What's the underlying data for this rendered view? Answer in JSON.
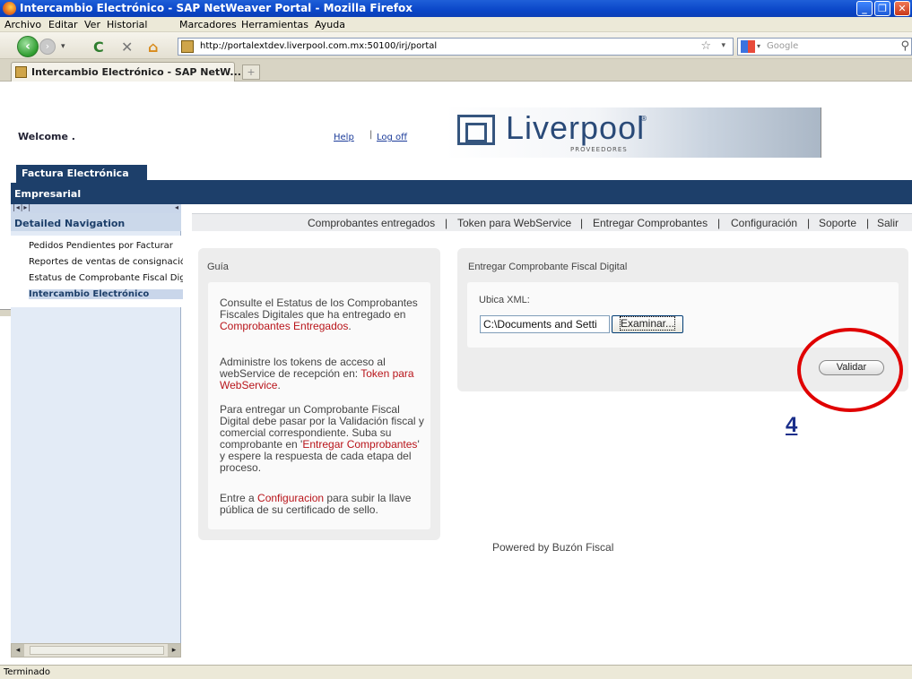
{
  "window": {
    "title": "Intercambio Electrónico - SAP NetWeaver Portal - Mozilla Firefox",
    "buttons": [
      "_",
      "❐",
      "✕"
    ]
  },
  "menubar": [
    "Archivo",
    "Editar",
    "Ver",
    "Historial",
    "Marcadores",
    "Herramientas",
    "Ayuda"
  ],
  "toolbar": {
    "url": "http://portalextdev.liverpool.com.mx:50100/irj/portal",
    "search_placeholder": "Google"
  },
  "tab": {
    "label": "Intercambio Electrónico - SAP NetW...",
    "new_tab": "+"
  },
  "header": {
    "welcome": "Welcome .",
    "help": "Help",
    "separator": "|",
    "logoff": "Log off",
    "brand": "Liverpool",
    "brand_reg": "®",
    "brand_sub": "PROVEEDORES"
  },
  "topnav": {
    "active_tab": "Factura Electrónica",
    "second_level": "Empresarial"
  },
  "detailed_nav": {
    "arrows_left": "|◂|▸|",
    "arrows_right": "◂",
    "title": "Detailed Navigation",
    "items": [
      "Pedidos Pendientes por Facturar",
      "Reportes de ventas de consignación",
      "Estatus de Comprobante Fiscal Digital",
      "Intercambio Electrónico"
    ]
  },
  "links": [
    "Comprobantes entregados",
    "|",
    "Token para WebService",
    "|",
    "Entregar Comprobantes",
    "|",
    "Configuración",
    "|",
    "Soporte",
    "|",
    "Salir"
  ],
  "guia": {
    "title": "Guía",
    "p1_text": "Consulte el Estatus de los Comprobantes Fiscales Digitales que ha entregado en ",
    "p1_link": "Comprobantes Entregados",
    "p1_end": ".",
    "p2_text": "Administre los tokens de acceso al webService de recepción en: ",
    "p2_link": "Token para WebService",
    "p2_end": ".",
    "p3_text": "Para entregar un Comprobante Fiscal Digital debe pasar por la Validación fiscal y comercial correspondiente. Suba su comprobante en '",
    "p3_link": "Entregar Comprobantes",
    "p3_end": "' y espere la respuesta de cada etapa del proceso.",
    "p4_text": "Entre a ",
    "p4_link": "Configuracion",
    "p4_end": " para subir la llave pública de su certificado de sello."
  },
  "entregar": {
    "title": "Entregar Comprobante Fiscal Digital",
    "ubica_label": "Ubica XML:",
    "file_value": "C:\\Documents and Setti",
    "browse_label": "Examinar...",
    "validar_label": "Validar"
  },
  "annotation": {
    "step": "4",
    "color": "#e00000"
  },
  "footer": {
    "powered": "Powered by Buzón Fiscal",
    "status": "Terminado"
  },
  "colors": {
    "portal_blue": "#1d3f6a",
    "link_red": "#b8141a"
  }
}
